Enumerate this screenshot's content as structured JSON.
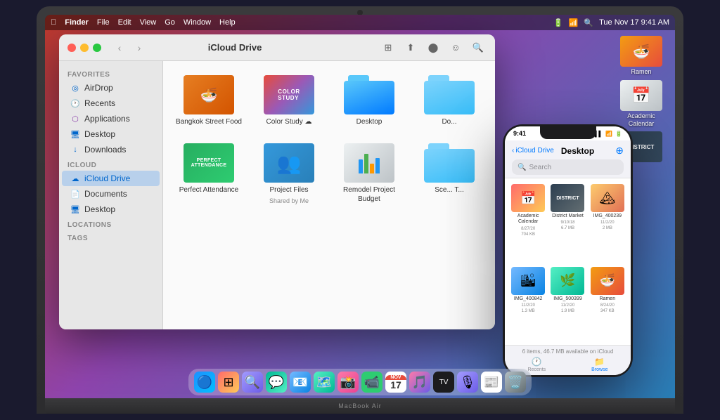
{
  "macbook": {
    "label": "MacBook Air"
  },
  "menubar": {
    "apple": "",
    "app_name": "Finder",
    "items": [
      "File",
      "Edit",
      "View",
      "Go",
      "Window",
      "Help"
    ],
    "time": "Tue Nov 17  9:41 AM"
  },
  "finder": {
    "title": "iCloud Drive",
    "sidebar": {
      "sections": [
        {
          "title": "Favorites",
          "items": [
            {
              "label": "AirDrop",
              "icon": "airdrop",
              "active": false
            },
            {
              "label": "Recents",
              "icon": "recents",
              "active": false
            },
            {
              "label": "Applications",
              "icon": "applications",
              "active": false
            },
            {
              "label": "Desktop",
              "icon": "desktop",
              "active": false
            },
            {
              "label": "Downloads",
              "icon": "downloads",
              "active": false
            }
          ]
        },
        {
          "title": "iCloud",
          "items": [
            {
              "label": "iCloud Drive",
              "icon": "icloud",
              "active": true
            },
            {
              "label": "Documents",
              "icon": "documents",
              "active": false
            },
            {
              "label": "Desktop",
              "icon": "desktop2",
              "active": false
            }
          ]
        },
        {
          "title": "Locations",
          "items": []
        },
        {
          "title": "Tags",
          "items": []
        }
      ]
    },
    "files": [
      {
        "name": "Bangkok Street Food",
        "type": "folder-image",
        "sub": ""
      },
      {
        "name": "Color Study",
        "type": "folder-color",
        "sub": "☁"
      },
      {
        "name": "Desktop",
        "type": "folder-blue",
        "sub": ""
      },
      {
        "name": "Do...",
        "type": "folder-light",
        "sub": ""
      },
      {
        "name": "Perfect Attendance",
        "type": "image-attendance",
        "sub": ""
      },
      {
        "name": "Project Files",
        "type": "folder-people",
        "sub": "Shared by Me"
      },
      {
        "name": "Remodel Project Budget",
        "type": "spreadsheet",
        "sub": ""
      },
      {
        "name": "Sce... T...",
        "type": "folder-light2",
        "sub": ""
      }
    ]
  },
  "iphone": {
    "time": "9:41",
    "nav_back": "iCloud Drive",
    "nav_title": "Desktop",
    "search_placeholder": "Search",
    "files": [
      {
        "name": "Academic Calendar",
        "date": "8/27/20",
        "size": "704 KB"
      },
      {
        "name": "District Market",
        "date": "9/10/18",
        "size": "6.7 MB"
      },
      {
        "name": "IMG_400239",
        "date": "11/2/20",
        "size": "2 MB"
      },
      {
        "name": "IMG_400842",
        "date": "11/2/20",
        "size": "1.3 MB"
      },
      {
        "name": "IMG_500399",
        "date": "11/2/20",
        "size": "1.9 MB"
      },
      {
        "name": "Ramen",
        "date": "8/24/20",
        "size": "347 KB"
      }
    ],
    "storage_info": "6 items, 46.7 MB available on iCloud",
    "tabs": [
      {
        "label": "Recents",
        "icon": "🕐",
        "active": false
      },
      {
        "label": "Browse",
        "icon": "📁",
        "active": true
      }
    ]
  },
  "desktop_icons": [
    {
      "label": "Ramen",
      "type": "food"
    },
    {
      "label": "Academic Calendar",
      "type": "calendar"
    },
    {
      "label": "District Market",
      "type": "district"
    }
  ],
  "dock": {
    "items": [
      "🔵",
      "⊞",
      "🔍",
      "💬",
      "📧",
      "🗺️",
      "📸",
      "📹",
      "NOV",
      "🎧",
      "🍎",
      "📺",
      "🎵",
      "🎙",
      "📰",
      "🗑️"
    ]
  }
}
